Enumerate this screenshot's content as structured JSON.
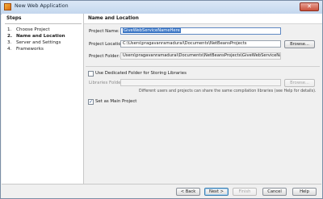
{
  "window": {
    "title": "New Web Application",
    "close_glyph": "✕"
  },
  "steps": {
    "title": "Steps",
    "items": [
      {
        "num": "1.",
        "label": "Choose Project"
      },
      {
        "num": "2.",
        "label": "Name and Location"
      },
      {
        "num": "3.",
        "label": "Server and Settings"
      },
      {
        "num": "4.",
        "label": "Frameworks"
      }
    ],
    "current_index": 1
  },
  "panel": {
    "title": "Name and Location",
    "project_name_label": "Project Name:",
    "project_name_value": "GiveWebServiceNameHere",
    "project_location_label": "Project Location:",
    "project_location_value": "C:\\Users\\pragavanramadurai\\Documents\\NetBeansProjects",
    "browse_label": "Browse...",
    "project_folder_label": "Project Folder:",
    "project_folder_value": "Users\\pragavanramadurai\\Documents\\NetBeansProjects\\GiveWebServiceNameHere",
    "dedicated_folder_label": "Use Dedicated Folder for Storing Libraries",
    "dedicated_folder_checked": false,
    "libraries_folder_label": "Libraries Folder:",
    "libraries_folder_value": "",
    "libraries_browse_label": "Browse...",
    "libraries_hint": "Different users and projects can share the same compilation libraries (see Help for details).",
    "main_project_label": "Set as Main Project",
    "main_project_checked": true
  },
  "footer": {
    "back_label": "< Back",
    "next_label": "Next >",
    "finish_label": "Finish",
    "cancel_label": "Cancel",
    "help_label": "Help"
  },
  "colors": {
    "accent": "#3a75c4",
    "titlebar": "#c4d7ee"
  },
  "icons": {
    "app": "netbeans-app-icon",
    "close": "close-icon",
    "check": "checkmark-icon"
  }
}
